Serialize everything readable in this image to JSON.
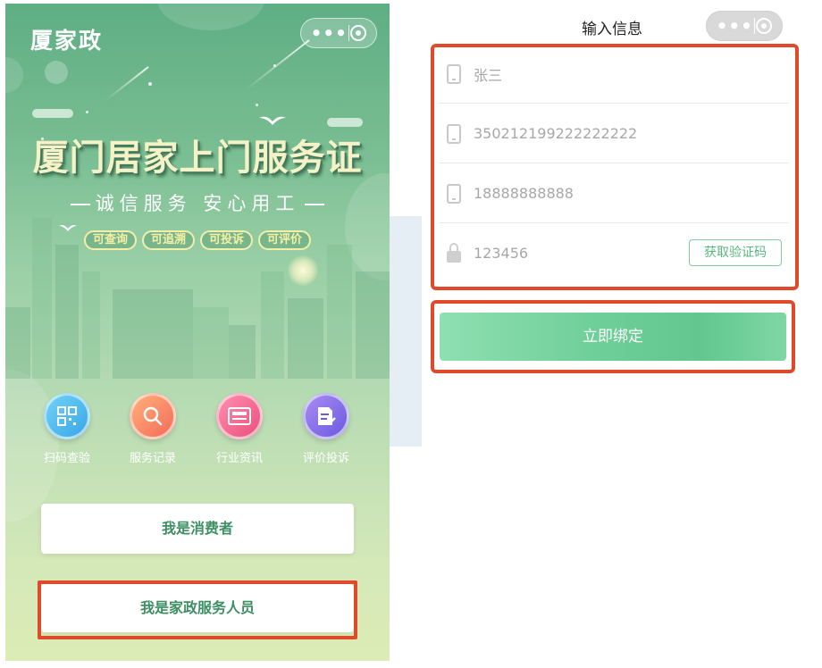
{
  "left_screen": {
    "app_title": "厦家政",
    "banner": {
      "title": "厦门居家上门服务证",
      "slogan": "诚信服务 安心用工",
      "badges": [
        "可查询",
        "可追溯",
        "可投诉",
        "可评价"
      ]
    },
    "quick_actions": [
      {
        "label": "扫码查验",
        "icon": "qr-code-icon"
      },
      {
        "label": "服务记录",
        "icon": "search-icon"
      },
      {
        "label": "行业资讯",
        "icon": "news-icon"
      },
      {
        "label": "评价投诉",
        "icon": "edit-document-icon"
      }
    ],
    "buttons": {
      "consumer": "我是消费者",
      "worker": "我是家政服务人员"
    }
  },
  "right_screen": {
    "header_title": "输入信息",
    "form": {
      "name": {
        "value": "张三",
        "icon": "phone-icon"
      },
      "id_number": {
        "value": "350212199222222222",
        "icon": "phone-icon"
      },
      "phone": {
        "value": "18888888888",
        "icon": "phone-icon"
      },
      "code": {
        "value": "123456",
        "icon": "lock-icon"
      },
      "get_code_label": "获取验证码"
    },
    "bind_label": "立即绑定"
  },
  "colors": {
    "brand_green": "#5bb882",
    "annotation_red": "#e04a2a"
  }
}
